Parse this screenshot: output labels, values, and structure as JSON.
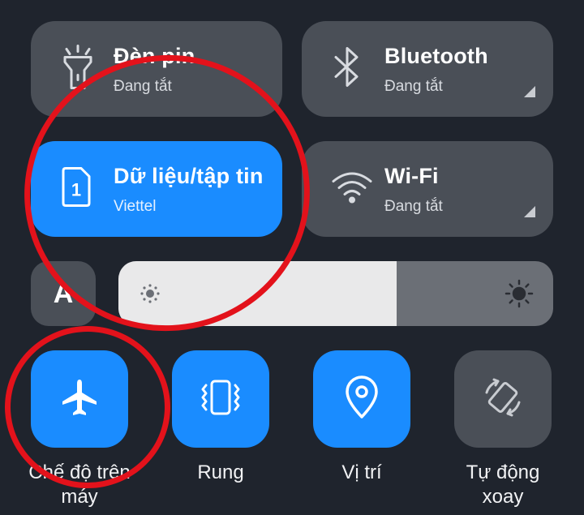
{
  "tiles": {
    "flashlight": {
      "title": "Đèn pin",
      "status": "Đang tắt"
    },
    "bluetooth": {
      "title": "Bluetooth",
      "status": "Đang tắt"
    },
    "mobile_data": {
      "title": "Dữ liệu/tập tin",
      "carrier": "Viettel",
      "sim_number": "1"
    },
    "wifi": {
      "title": "Wi-Fi",
      "status": "Đang tắt"
    }
  },
  "brightness": {
    "auto_label": "A",
    "level": 0.64
  },
  "toggles": [
    {
      "label": "Chế độ trên máy",
      "icon": "airplane-icon",
      "active": true
    },
    {
      "label": "Rung",
      "icon": "vibrate-icon",
      "active": true
    },
    {
      "label": "Vị trí",
      "icon": "location-pin-icon",
      "active": true
    },
    {
      "label": "Tự động xoay",
      "icon": "auto-rotate-icon",
      "active": false
    }
  ],
  "colors": {
    "accent": "#1a8cff",
    "tile_off": "#4a4f57",
    "background": "#1f242d",
    "annotation": "#e3121b"
  }
}
